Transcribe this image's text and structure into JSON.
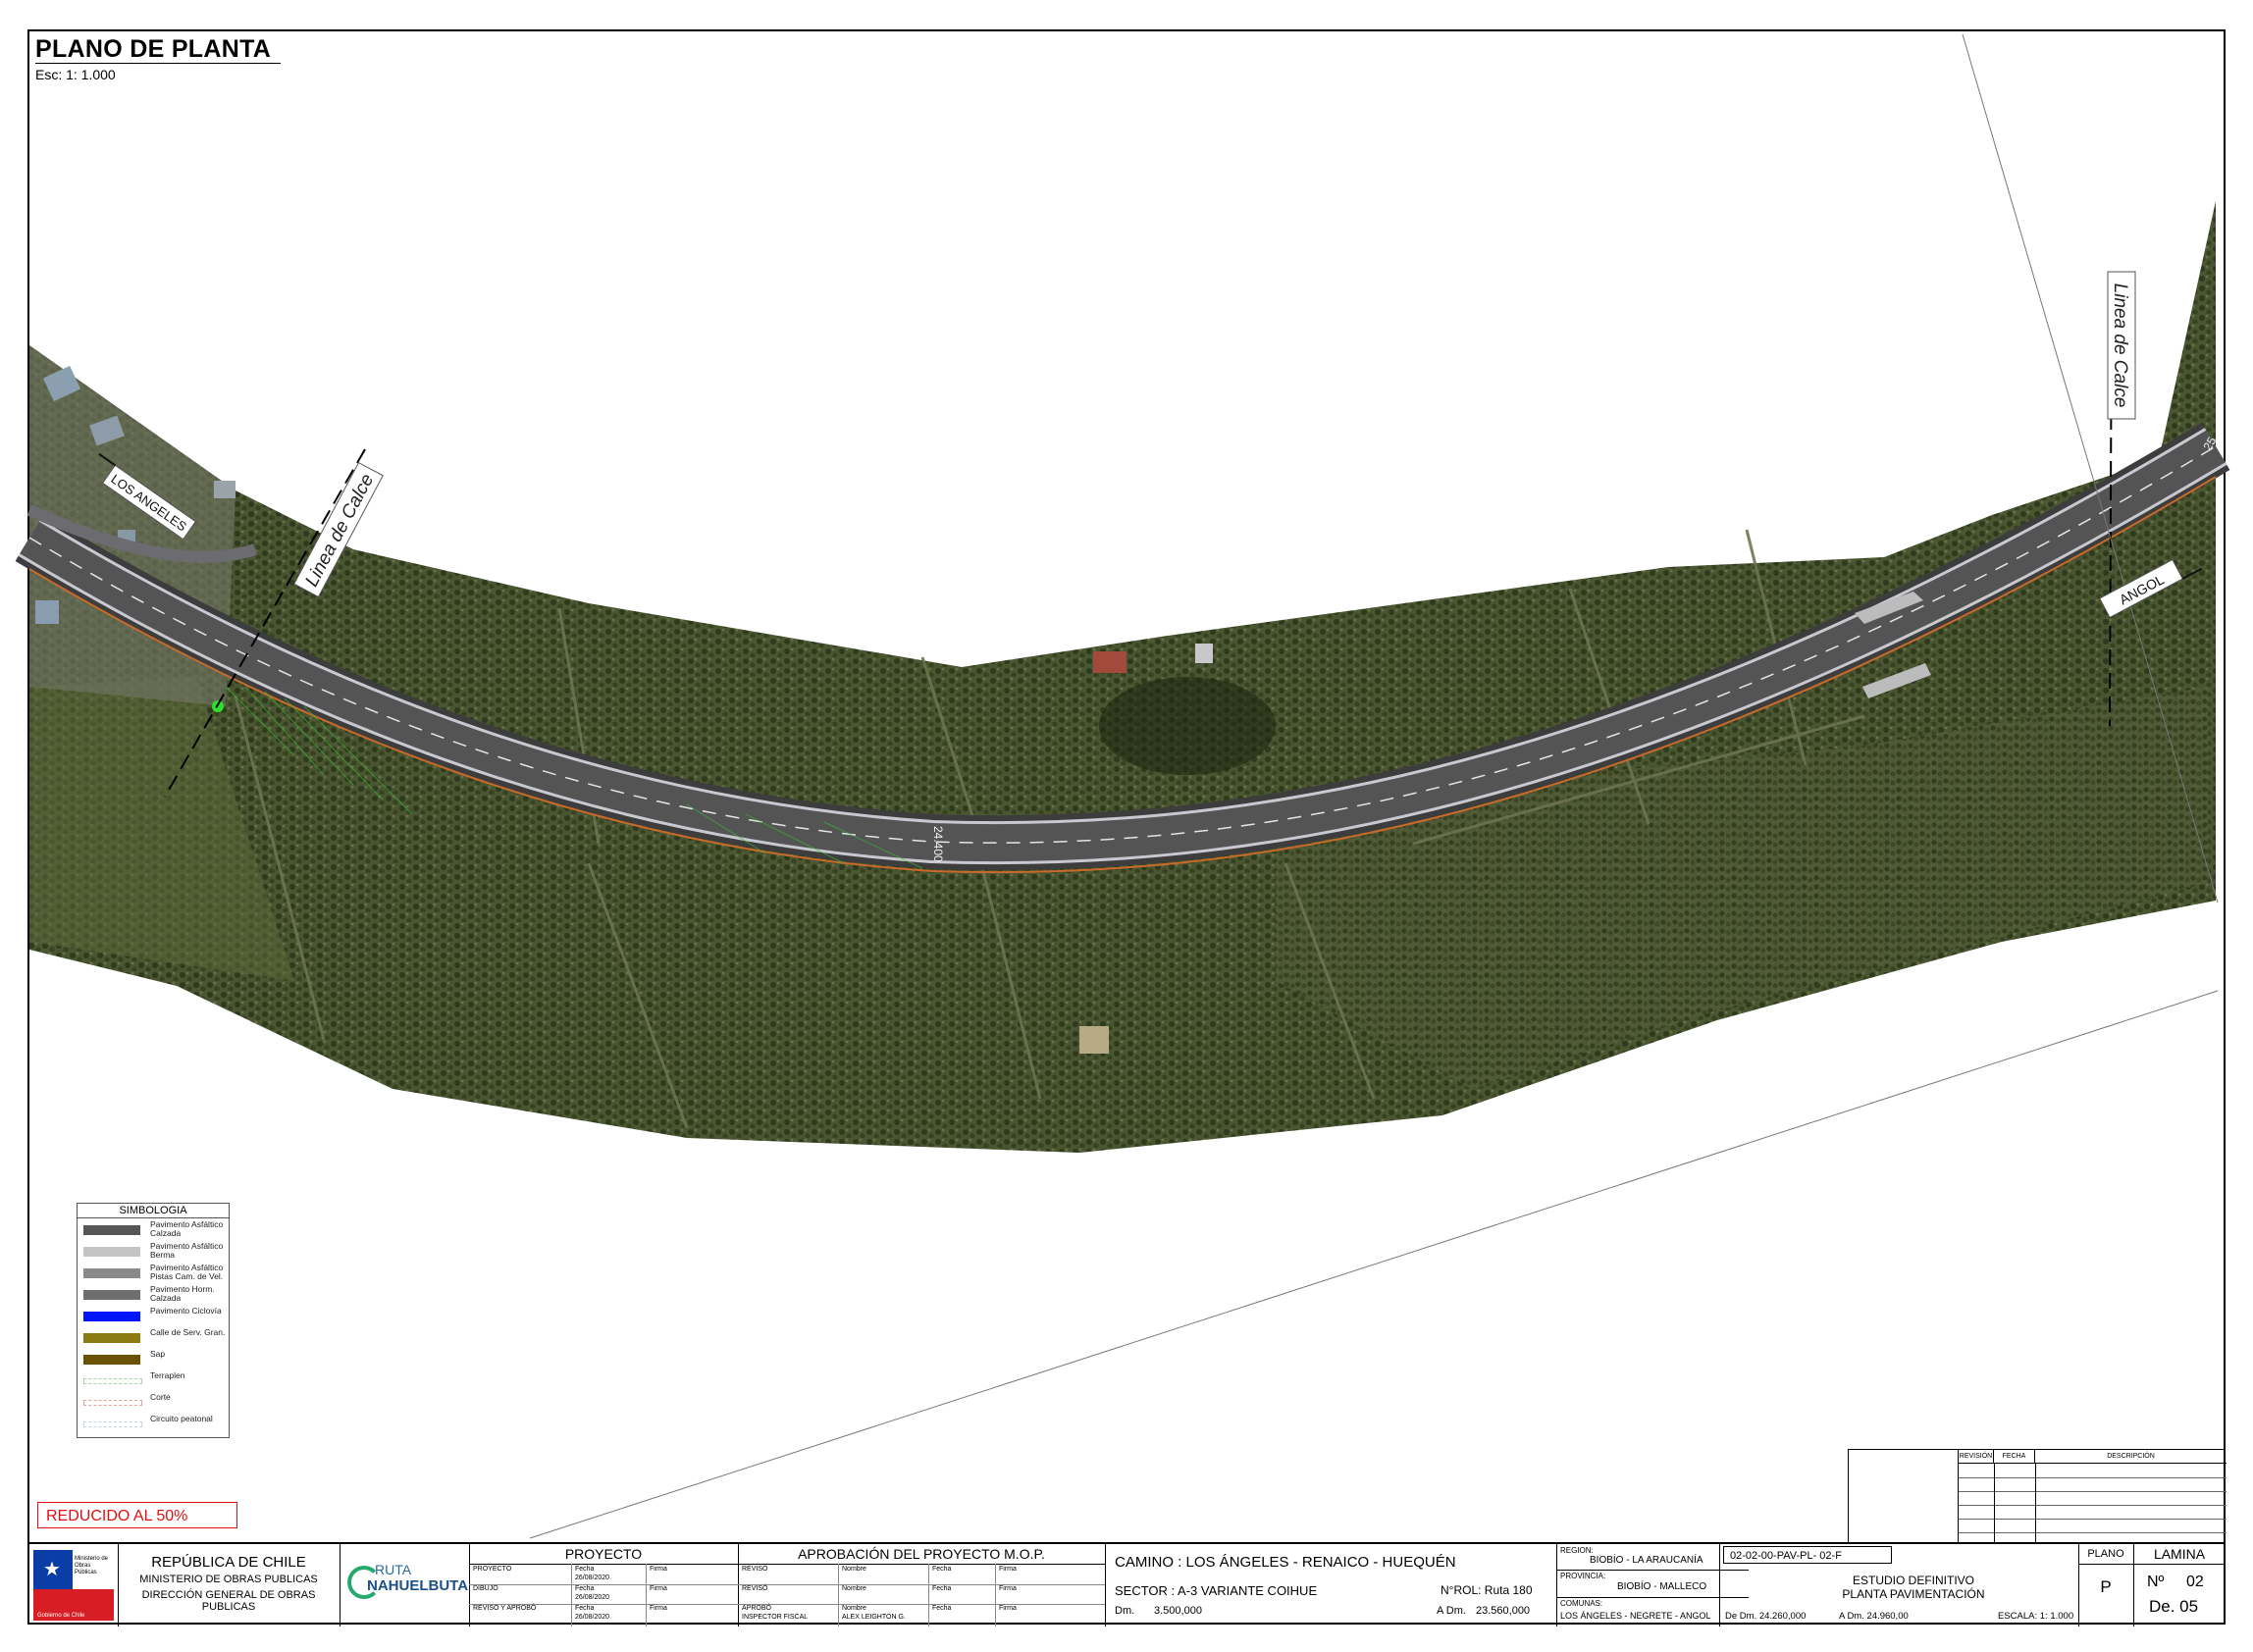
{
  "sheet": {
    "title": "PLANO DE PLANTA",
    "scale_note": "Esc: 1: 1.000",
    "reduced_note": "REDUCIDO AL 50%"
  },
  "map_labels": {
    "direction_west": "LOS ANGELES",
    "direction_east": "ANGOL",
    "calce_left": "Linea de Calce",
    "calce_right": "Linea de Calce",
    "station": "24.400",
    "station_edge": "25"
  },
  "legend": {
    "header": "SIMBOLOGIA",
    "items": [
      {
        "label": "Pavimento Asfáltico Calzada",
        "color": "#555555"
      },
      {
        "label": "Pavimento Asfáltico Berma",
        "color": "#c4c4c4"
      },
      {
        "label": "Pavimento Asfáltico Pistas Cam. de Vel.",
        "color": "#8a8a8a"
      },
      {
        "label": "Pavimento Horm. Calzada",
        "color": "#6e6e6e"
      },
      {
        "label": "Pavimento Ciclovía",
        "color": "#0014ff"
      },
      {
        "label": "Calle de Serv. Gran.",
        "color": "#8c7a12"
      },
      {
        "label": "Sap",
        "color": "#6b5200"
      },
      {
        "label": "Terraplen",
        "color": "#9fd89f"
      },
      {
        "label": "Corte",
        "color": "#e8a0a0"
      },
      {
        "label": "Circuito peatonal",
        "color": "#c9d4e8"
      }
    ]
  },
  "revision_table": {
    "col_revision": "REVISIÓN",
    "col_fecha": "FECHA",
    "col_descripcion": "DESCRIPCIÓN"
  },
  "title_block": {
    "org_line1": "REPÚBLICA DE CHILE",
    "org_line2": "MINISTERIO DE OBRAS PUBLICAS",
    "org_line3": "DIRECCIÓN GENERAL DE OBRAS PUBLICAS",
    "seal_top": "Ministerio de Obras Públicas",
    "seal_bottom": "Gobierno de Chile",
    "logo_text_top": "RUTA",
    "logo_text_bottom": "NAHUELBUTA",
    "proyecto_head": "PROYECTO",
    "proyecto_rows": [
      {
        "role": "PROYECTÓ",
        "fecha_label": "Fecha",
        "fecha": "26/08/2020",
        "firma": "Firma"
      },
      {
        "role": "DIBUJO",
        "fecha_label": "Fecha",
        "fecha": "26/08/2020",
        "firma": "Firma"
      },
      {
        "role": "REVISO Y APROBÓ",
        "fecha_label": "Fecha",
        "fecha": "26/08/2020",
        "firma": "Firma"
      }
    ],
    "aprob_head": "APROBACIÓN DEL PROYECTO M.O.P.",
    "aprob_rows": [
      {
        "role": "REVISÓ",
        "nombre_label": "Nombre",
        "nombre": "",
        "fecha": "Fecha",
        "firma": "Firma"
      },
      {
        "role": "REVISÓ",
        "nombre_label": "Nombre",
        "nombre": "",
        "fecha": "Fecha",
        "firma": "Firma"
      },
      {
        "role": "APROBÓ",
        "role2": "INSPECTOR FISCAL",
        "nombre_label": "Nombre",
        "nombre": "ALEX LEIGHTON G.",
        "fecha": "Fecha",
        "firma": "Firma"
      }
    ],
    "camino": "CAMINO : LOS ÁNGELES - RENAICO - HUEQUÉN",
    "sector": "SECTOR : A-3 VARIANTE COIHUE",
    "rol": "N°ROL: Ruta 180",
    "dm_label": "Dm.",
    "dm_value": "3.500,000",
    "adm_label": "A Dm.",
    "adm_value": "23.560,000",
    "region_label": "REGION:",
    "region_value": "BIOBÍO - LA ARAUCANÍA",
    "provincia_label": "PROVINCIA:",
    "provincia_value": "BIOBÍO - MALLECO",
    "comunas_label": "COMUNAS:",
    "comunas_value": "LOS ÁNGELES - NEGRETE - ANGOL",
    "plan_code": "02-02-00-PAV-PL- 02-F",
    "desc_line1": "ESTUDIO DEFINITIVO",
    "desc_line2": "PLANTA PAVIMENTACIÓN",
    "de_dm": "De Dm. 24.260,000",
    "a_dm": "A Dm.   24.960,00",
    "escala": "ESCALA:  1: 1.000",
    "plano_label": "PLANO",
    "plano_value": "P",
    "lamina_label": "LAMINA",
    "lamina_no_label": "Nº",
    "lamina_no": "02",
    "lamina_de": "De. 05"
  }
}
